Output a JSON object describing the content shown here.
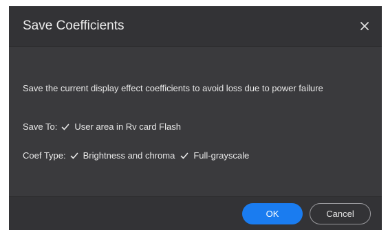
{
  "dialog": {
    "title": "Save Coefficients",
    "message": "Save the current display effect coefficients to avoid loss due to power failure",
    "save_to": {
      "label": "Save To:",
      "option_label": "User area in Rv card Flash",
      "checked": true
    },
    "coef_type": {
      "label": "Coef Type:",
      "options": [
        {
          "label": "Brightness and chroma",
          "checked": true
        },
        {
          "label": "Full-grayscale",
          "checked": true
        }
      ]
    },
    "ok_label": "OK",
    "cancel_label": "Cancel"
  },
  "colors": {
    "dialog_bg": "#3a3a3d",
    "primary_button": "#1a7cf0",
    "text": "#e8e8e8"
  }
}
